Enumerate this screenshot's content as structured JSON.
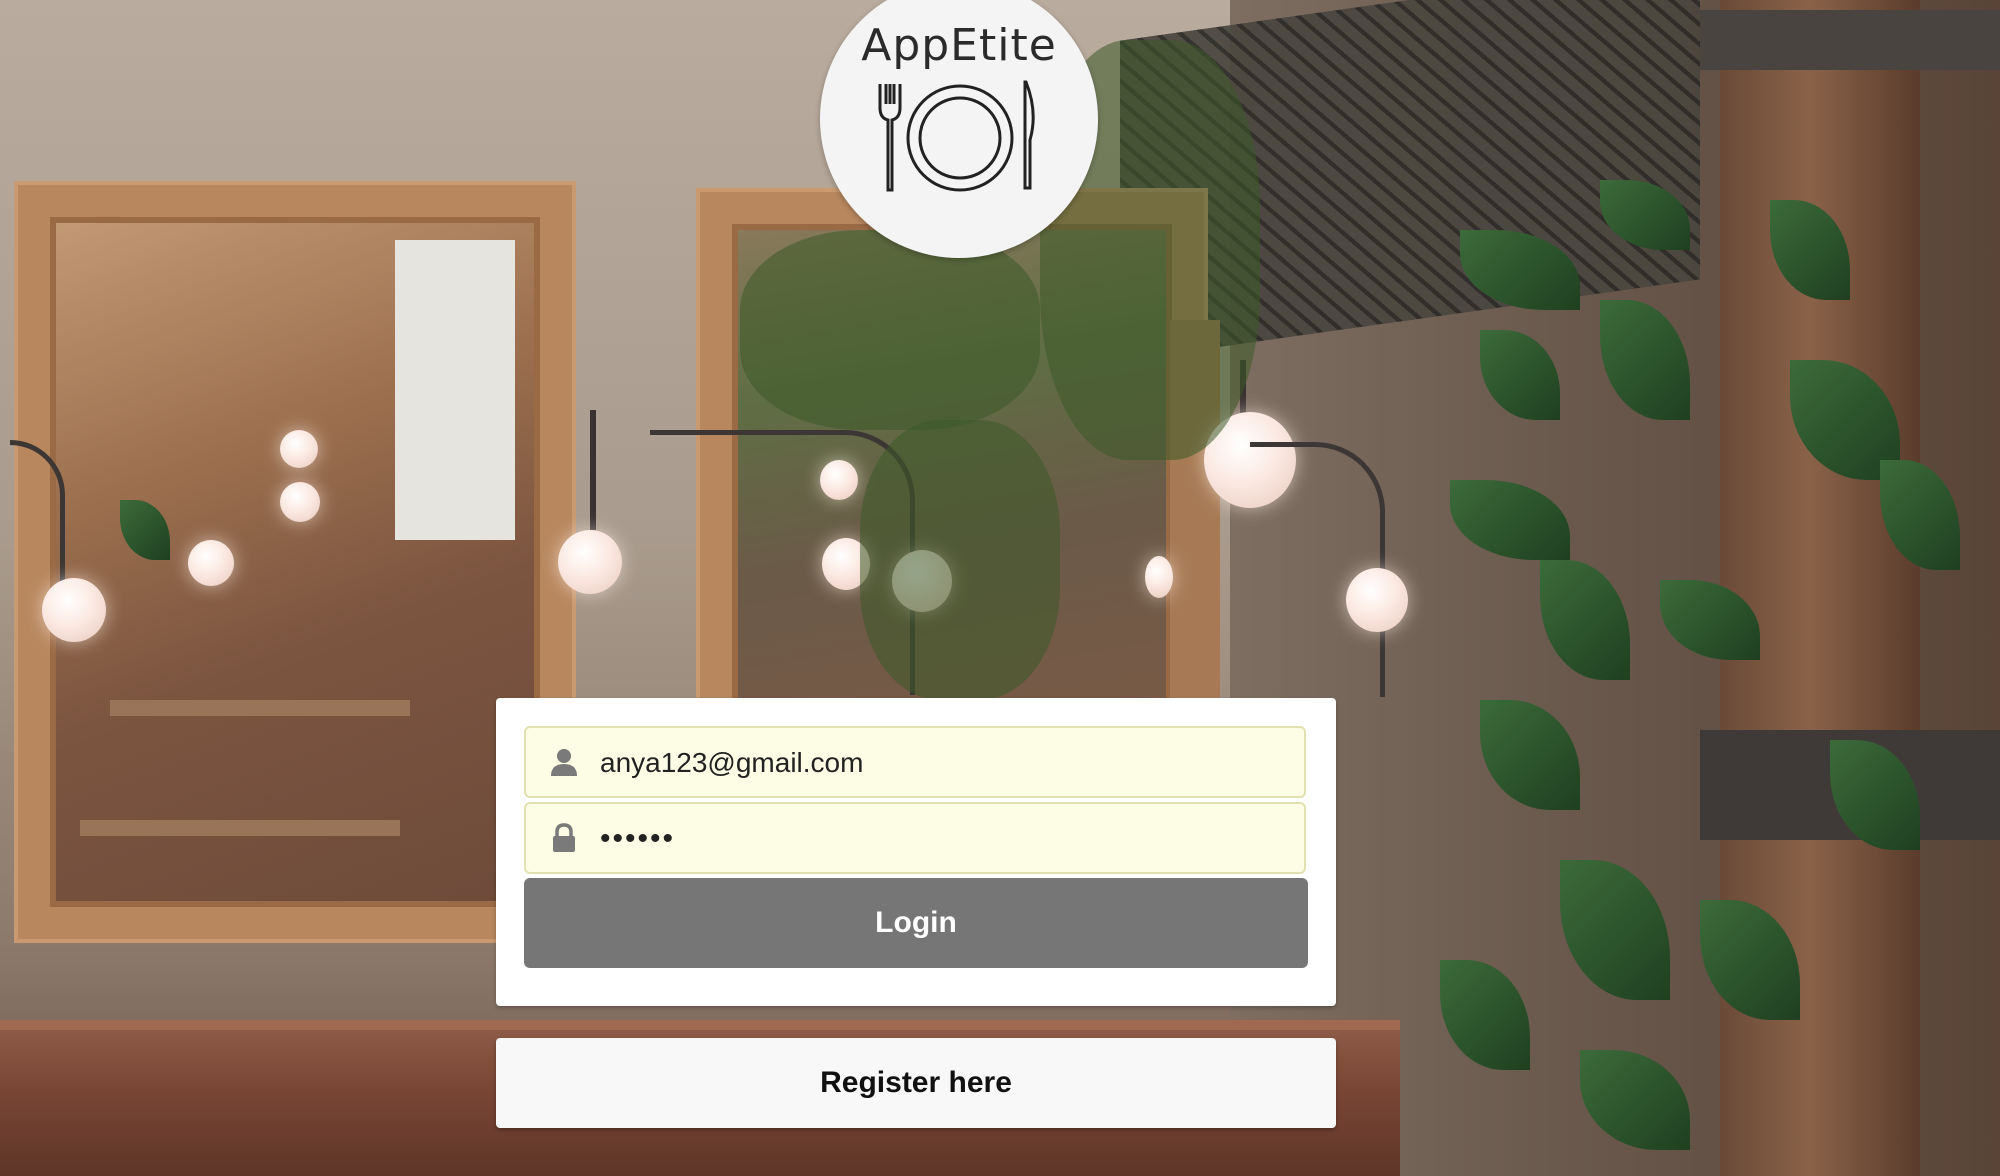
{
  "logo": {
    "title": "AppEtite",
    "icon": "plate-fork-knife-icon"
  },
  "login_form": {
    "email": {
      "value": "anya123@gmail.com",
      "icon": "user-icon"
    },
    "password": {
      "value": "••••••",
      "icon": "lock-icon"
    },
    "login_label": "Login"
  },
  "register_label": "Register here",
  "colors": {
    "login_button": "#767676",
    "field_background": "#fdfde6",
    "card_background": "#ffffff"
  }
}
